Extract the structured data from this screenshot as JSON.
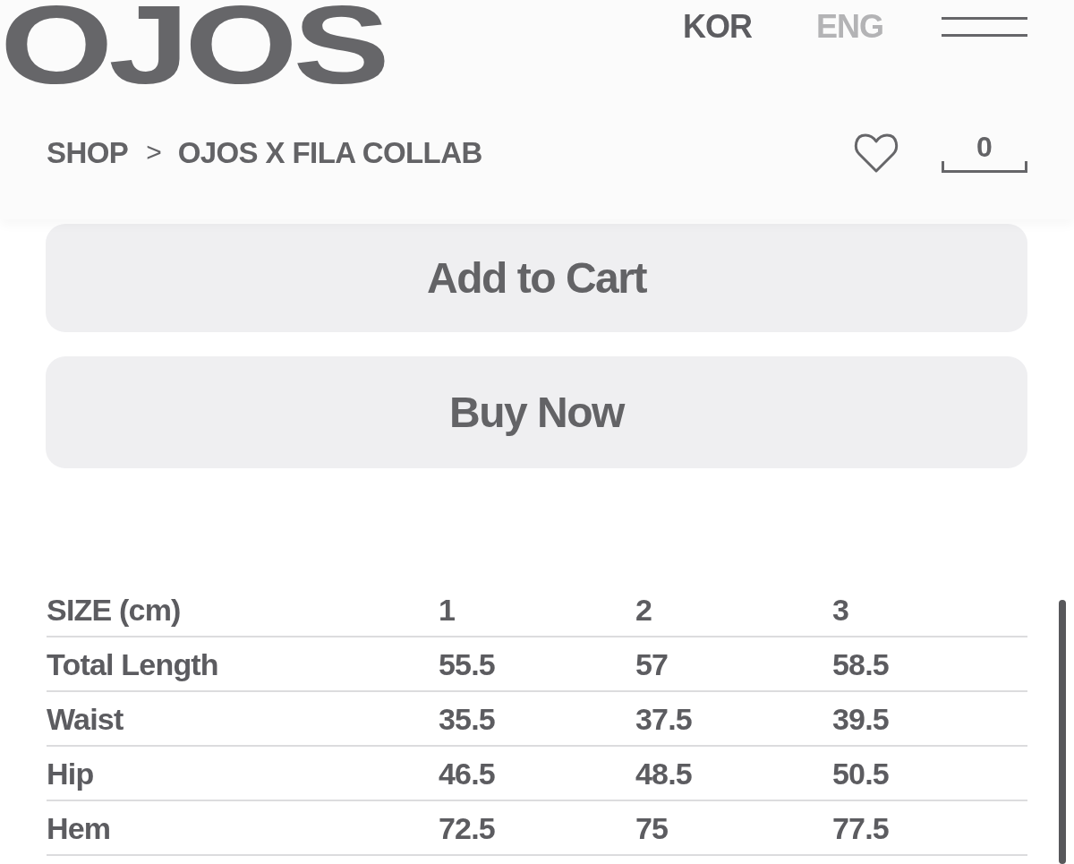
{
  "header": {
    "logo": "OJOS",
    "languages": [
      {
        "label": "KOR",
        "selected": true
      },
      {
        "label": "ENG",
        "selected": false
      }
    ]
  },
  "breadcrumb": {
    "items": [
      "SHOP",
      "OJOS X FILA COLLAB"
    ],
    "separator": ">"
  },
  "cart": {
    "count": "0"
  },
  "actions": [
    {
      "label": "Add to Cart"
    },
    {
      "label": "Buy Now"
    }
  ],
  "size_table": {
    "columns": [
      "SIZE (cm)",
      "1",
      "2",
      "3"
    ],
    "rows": [
      {
        "label": "Total Length",
        "values": [
          "55.5",
          "57",
          "58.5"
        ]
      },
      {
        "label": "Waist",
        "values": [
          "35.5",
          "37.5",
          "39.5"
        ]
      },
      {
        "label": "Hip",
        "values": [
          "46.5",
          "48.5",
          "50.5"
        ]
      },
      {
        "label": "Hem",
        "values": [
          "72.5",
          "75",
          "77.5"
        ]
      }
    ]
  }
}
